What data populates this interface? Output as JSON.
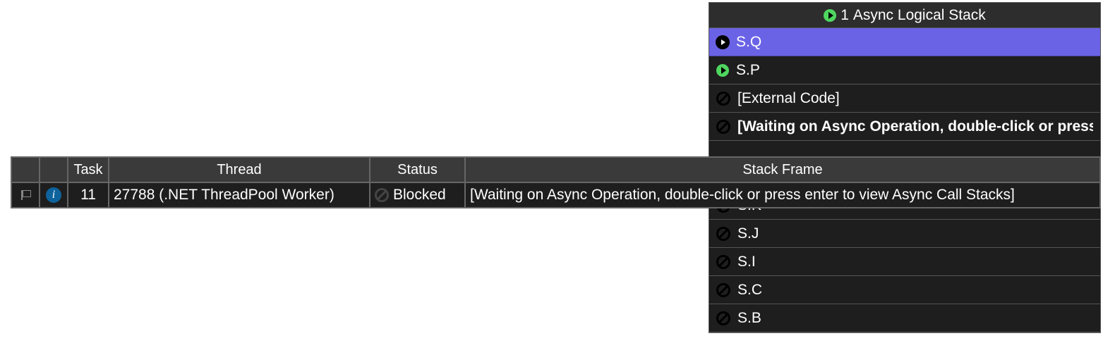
{
  "stack_panel": {
    "header_count": "1",
    "header_label": "Async Logical Stack",
    "frames": [
      {
        "icon": "play-black",
        "label": "S.Q",
        "state": "selected"
      },
      {
        "icon": "play-green",
        "label": "S.P",
        "state": ""
      },
      {
        "icon": "no",
        "label": "[External Code]",
        "state": ""
      },
      {
        "icon": "no",
        "label": "[Waiting on Async Operation, double-click or press enter to view Async Call Stacks]",
        "state": "bold"
      },
      {
        "icon": "no",
        "label": "S.K",
        "state": ""
      },
      {
        "icon": "no",
        "label": "S.J",
        "state": ""
      },
      {
        "icon": "no",
        "label": "S.I",
        "state": ""
      },
      {
        "icon": "no",
        "label": "S.C",
        "state": ""
      },
      {
        "icon": "no",
        "label": "S.B",
        "state": ""
      }
    ]
  },
  "thread_grid": {
    "columns": {
      "flag": "",
      "info": "",
      "task": "Task",
      "thread": "Thread",
      "status": "Status",
      "stack_frame": "Stack Frame"
    },
    "row": {
      "task": "11",
      "thread": "27788 (.NET ThreadPool Worker)",
      "status": "Blocked",
      "stack_frame": "[Waiting on Async Operation, double-click or press enter to view Async Call Stacks]"
    }
  }
}
